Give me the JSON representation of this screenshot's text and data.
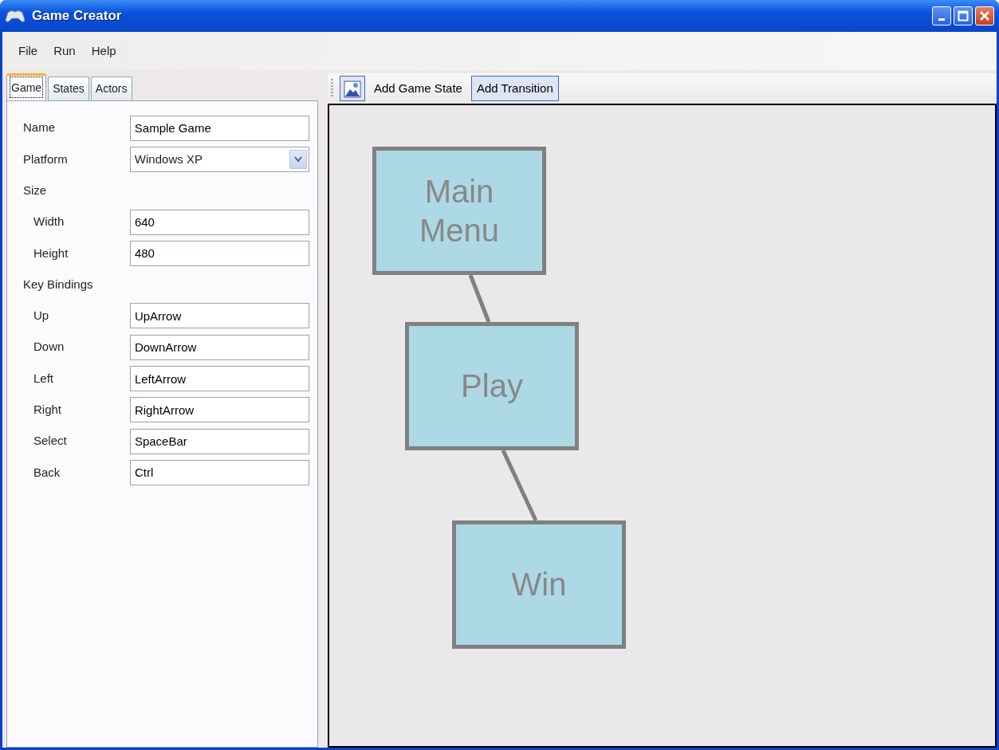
{
  "window": {
    "title": "Game Creator"
  },
  "menu": [
    "File",
    "Run",
    "Help"
  ],
  "tabs": [
    {
      "label": "Game",
      "selected": true
    },
    {
      "label": "States",
      "selected": false
    },
    {
      "label": "Actors",
      "selected": false
    }
  ],
  "properties": [
    {
      "kind": "text",
      "label": "Name",
      "value": "Sample Game"
    },
    {
      "kind": "select",
      "label": "Platform",
      "value": "Windows XP"
    },
    {
      "kind": "group",
      "label": "Size",
      "children": [
        {
          "kind": "text",
          "label": "Width",
          "value": "640"
        },
        {
          "kind": "text",
          "label": "Height",
          "value": "480"
        }
      ]
    },
    {
      "kind": "group",
      "label": "Key Bindings",
      "children": [
        {
          "kind": "text",
          "label": "Up",
          "value": "UpArrow"
        },
        {
          "kind": "text",
          "label": "Down",
          "value": "DownArrow"
        },
        {
          "kind": "text",
          "label": "Left",
          "value": "LeftArrow"
        },
        {
          "kind": "text",
          "label": "Right",
          "value": "RightArrow"
        },
        {
          "kind": "text",
          "label": "Select",
          "value": "SpaceBar"
        },
        {
          "kind": "text",
          "label": "Back",
          "value": "Ctrl"
        }
      ]
    }
  ],
  "toolbar": [
    {
      "kind": "icon",
      "selected": true
    },
    {
      "kind": "text",
      "label": "Add Game State",
      "selected": false
    },
    {
      "kind": "text",
      "label": "Add Transition",
      "selected": true
    }
  ],
  "diagram": {
    "states": [
      {
        "label": "Main Menu"
      },
      {
        "label": "Play"
      },
      {
        "label": "Win"
      }
    ]
  }
}
